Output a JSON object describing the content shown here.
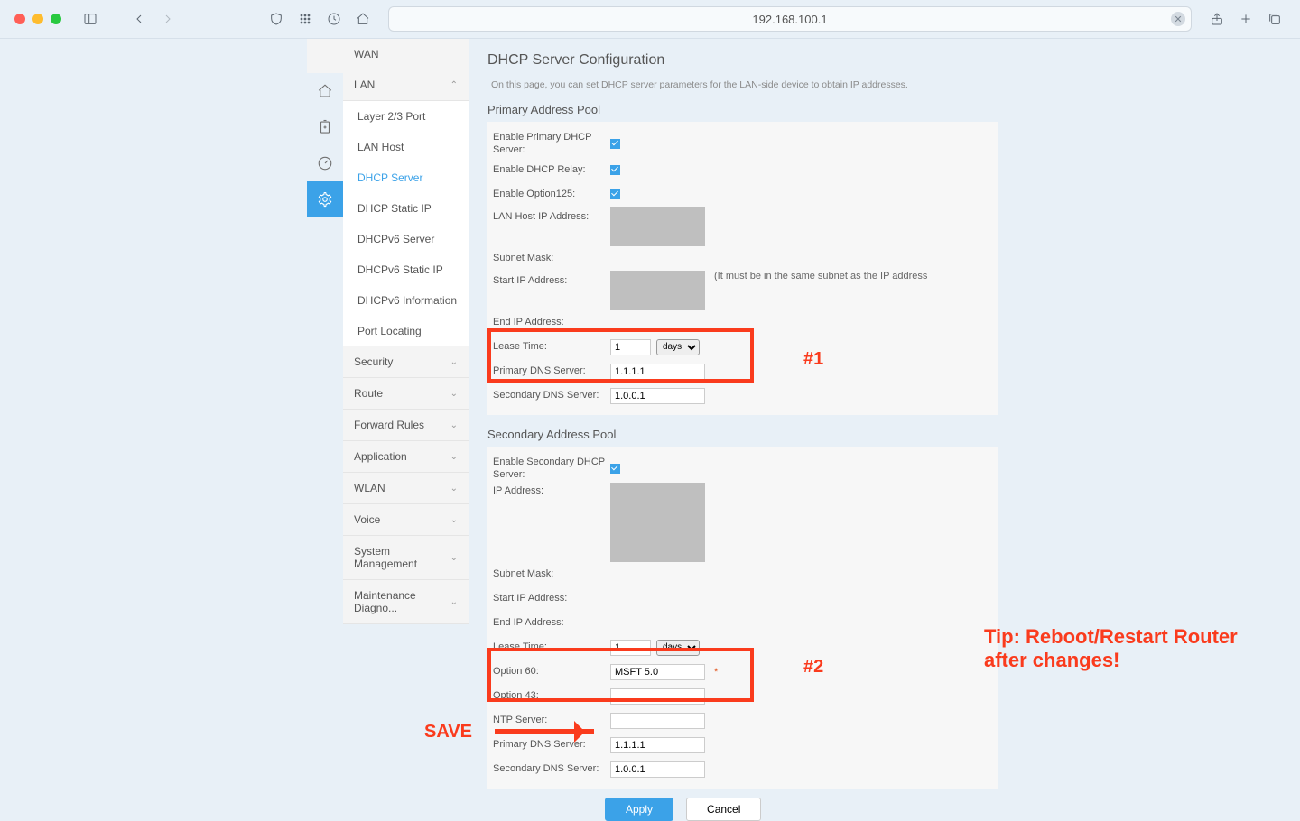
{
  "browser": {
    "url": "192.168.100.1"
  },
  "iconRail": {
    "items": [
      "home",
      "clipboard",
      "meter",
      "gear"
    ]
  },
  "nav": {
    "wan": "WAN",
    "lan": {
      "label": "LAN",
      "items": [
        "Layer 2/3 Port",
        "LAN Host",
        "DHCP Server",
        "DHCP Static IP",
        "DHCPv6 Server",
        "DHCPv6 Static IP",
        "DHCPv6 Information",
        "Port Locating"
      ],
      "activeIndex": 2
    },
    "groups": [
      "Security",
      "Route",
      "Forward Rules",
      "Application",
      "WLAN",
      "Voice",
      "System Management",
      "Maintenance Diagno..."
    ]
  },
  "main": {
    "title": "DHCP Server Configuration",
    "desc": "On this page, you can set DHCP server parameters for the LAN-side device to obtain IP addresses.",
    "primary": {
      "heading": "Primary Address Pool",
      "labels": {
        "enablePrimary": "Enable Primary DHCP Server:",
        "enableRelay": "Enable DHCP Relay:",
        "enableOption125": "Enable Option125:",
        "lanHostIp": "LAN Host IP Address:",
        "subnetMask": "Subnet Mask:",
        "startIp": "Start IP Address:",
        "endIp": "End IP Address:",
        "leaseTime": "Lease Time:",
        "primaryDns": "Primary DNS Server:",
        "secondaryDns": "Secondary DNS Server:"
      },
      "values": {
        "enablePrimary": true,
        "enableRelay": true,
        "enableOption125": true,
        "leaseTime": "1",
        "leaseUnit": "days",
        "primaryDns": "1.1.1.1",
        "secondaryDns": "1.0.0.1"
      },
      "note": "(It must be in the same subnet as the IP address"
    },
    "secondary": {
      "heading": "Secondary Address Pool",
      "labels": {
        "enableSecondary": "Enable Secondary DHCP Server:",
        "ipAddress": "IP Address:",
        "subnetMask": "Subnet Mask:",
        "startIp": "Start IP Address:",
        "endIp": "End IP Address:",
        "leaseTime": "Lease Time:",
        "option60": "Option 60:",
        "option43": "Option 43:",
        "ntpServer": "NTP Server:",
        "primaryDns": "Primary DNS Server:",
        "secondaryDns": "Secondary DNS Server:"
      },
      "values": {
        "enableSecondary": true,
        "leaseTime": "1",
        "leaseUnit": "days",
        "option60": "MSFT 5.0",
        "option43": "",
        "ntpServer": "",
        "primaryDns": "1.1.1.1",
        "secondaryDns": "1.0.0.1"
      }
    },
    "buttons": {
      "apply": "Apply",
      "cancel": "Cancel"
    }
  },
  "annotations": {
    "tag1": "#1",
    "tag2": "#2",
    "save": "SAVE",
    "tip": "Tip: Reboot/Restart Router after changes!"
  }
}
